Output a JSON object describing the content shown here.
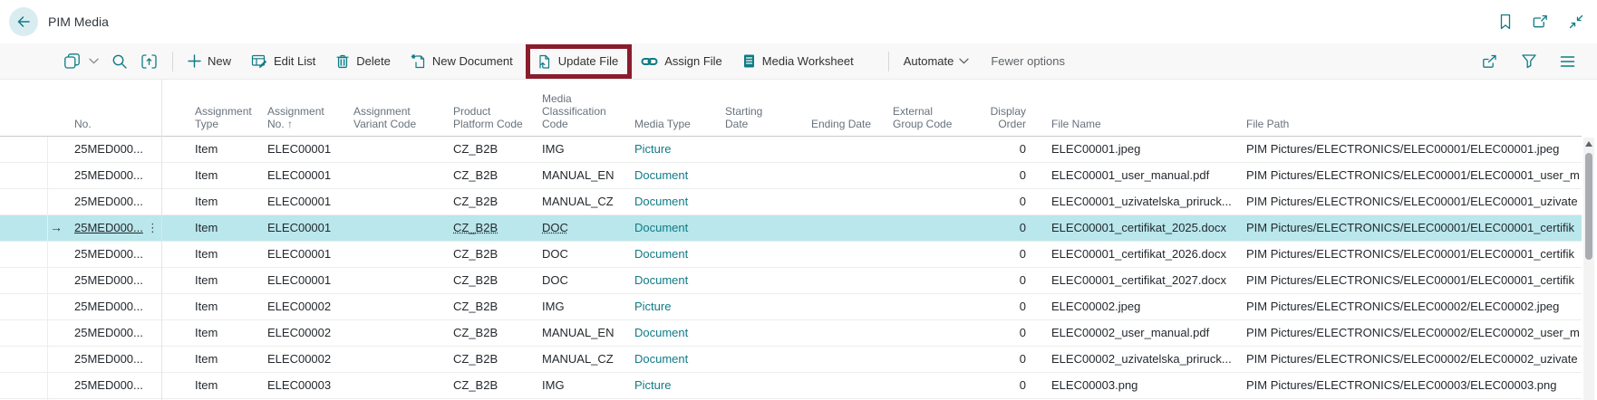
{
  "app_header": {
    "title": "PIM Media",
    "icons": [
      "back-arrow",
      "bookmark",
      "open-in-new-window",
      "collapse"
    ]
  },
  "command_bar": {
    "left_icons": [
      "views",
      "search",
      "analyze",
      "chevron-down"
    ],
    "buttons": [
      {
        "label": "New",
        "icon": "plus"
      },
      {
        "label": "Edit List",
        "icon": "table-edit"
      },
      {
        "label": "Delete",
        "icon": "trash"
      },
      {
        "label": "New Document",
        "icon": "document-new"
      },
      {
        "label": "Update File",
        "icon": "file-update",
        "highlighted": true
      },
      {
        "label": "Assign File",
        "icon": "chain-link"
      },
      {
        "label": "Media Worksheet",
        "icon": "worksheet"
      }
    ],
    "automate_label": "Automate",
    "fewer_options_label": "Fewer options",
    "right_icons": [
      "share",
      "filter-funnel",
      "column-options"
    ],
    "highlight_box_color": "#8a1c2c"
  },
  "table": {
    "columns": [
      {
        "key": "no",
        "label_lines": [
          "No."
        ]
      },
      {
        "key": "assignment_type",
        "label_lines": [
          "Assignment",
          "Type"
        ]
      },
      {
        "key": "assignment_no",
        "label_lines": [
          "Assignment",
          "No. ↑"
        ]
      },
      {
        "key": "assignment_variant_code",
        "label_lines": [
          "Assignment",
          "Variant Code"
        ]
      },
      {
        "key": "product_platform_code",
        "label_lines": [
          "Product",
          "Platform Code"
        ]
      },
      {
        "key": "media_classification_code",
        "label_lines": [
          "Media",
          "Classification",
          "Code"
        ]
      },
      {
        "key": "media_type",
        "label_lines": [
          "Media Type"
        ]
      },
      {
        "key": "starting_date",
        "label_lines": [
          "Starting",
          "Date"
        ]
      },
      {
        "key": "ending_date",
        "label_lines": [
          "Ending Date"
        ]
      },
      {
        "key": "external_group_code",
        "label_lines": [
          "External",
          "Group Code"
        ]
      },
      {
        "key": "display_order",
        "label_lines": [
          "Display",
          "Order"
        ]
      },
      {
        "key": "file_name",
        "label_lines": [
          "File Name"
        ]
      },
      {
        "key": "file_path",
        "label_lines": [
          "File Path"
        ]
      }
    ],
    "selected_row_index": 3,
    "selected_arrow_glyph": "→",
    "row_menu_glyph": "⋮",
    "rows": [
      {
        "no": "25MED000...",
        "assignment_type": "Item",
        "assignment_no": "ELEC00001",
        "assignment_variant_code": "",
        "product_platform_code": "CZ_B2B",
        "media_classification_code": "IMG",
        "media_type": "Picture",
        "starting_date": "",
        "ending_date": "",
        "external_group_code": "",
        "display_order": "0",
        "file_name": "ELEC00001.jpeg",
        "file_path": "PIM Pictures/ELECTRONICS/ELEC00001/ELEC00001.jpeg"
      },
      {
        "no": "25MED000...",
        "assignment_type": "Item",
        "assignment_no": "ELEC00001",
        "assignment_variant_code": "",
        "product_platform_code": "CZ_B2B",
        "media_classification_code": "MANUAL_EN",
        "media_type": "Document",
        "starting_date": "",
        "ending_date": "",
        "external_group_code": "",
        "display_order": "0",
        "file_name": "ELEC00001_user_manual.pdf",
        "file_path": "PIM Pictures/ELECTRONICS/ELEC00001/ELEC00001_user_m"
      },
      {
        "no": "25MED000...",
        "assignment_type": "Item",
        "assignment_no": "ELEC00001",
        "assignment_variant_code": "",
        "product_platform_code": "CZ_B2B",
        "media_classification_code": "MANUAL_CZ",
        "media_type": "Document",
        "starting_date": "",
        "ending_date": "",
        "external_group_code": "",
        "display_order": "0",
        "file_name": "ELEC00001_uzivatelska_priruck...",
        "file_path": "PIM Pictures/ELECTRONICS/ELEC00001/ELEC00001_uzivate"
      },
      {
        "no": "25MED000...",
        "assignment_type": "Item",
        "assignment_no": "ELEC00001",
        "assignment_variant_code": "",
        "product_platform_code": "CZ_B2B",
        "media_classification_code": "DOC",
        "media_type": "Document",
        "starting_date": "",
        "ending_date": "",
        "external_group_code": "",
        "display_order": "0",
        "file_name": "ELEC00001_certifikat_2025.docx",
        "file_path": "PIM Pictures/ELECTRONICS/ELEC00001/ELEC00001_certifik"
      },
      {
        "no": "25MED000...",
        "assignment_type": "Item",
        "assignment_no": "ELEC00001",
        "assignment_variant_code": "",
        "product_platform_code": "CZ_B2B",
        "media_classification_code": "DOC",
        "media_type": "Document",
        "starting_date": "",
        "ending_date": "",
        "external_group_code": "",
        "display_order": "0",
        "file_name": "ELEC00001_certifikat_2026.docx",
        "file_path": "PIM Pictures/ELECTRONICS/ELEC00001/ELEC00001_certifik"
      },
      {
        "no": "25MED000...",
        "assignment_type": "Item",
        "assignment_no": "ELEC00001",
        "assignment_variant_code": "",
        "product_platform_code": "CZ_B2B",
        "media_classification_code": "DOC",
        "media_type": "Document",
        "starting_date": "",
        "ending_date": "",
        "external_group_code": "",
        "display_order": "0",
        "file_name": "ELEC00001_certifikat_2027.docx",
        "file_path": "PIM Pictures/ELECTRONICS/ELEC00001/ELEC00001_certifik"
      },
      {
        "no": "25MED000...",
        "assignment_type": "Item",
        "assignment_no": "ELEC00002",
        "assignment_variant_code": "",
        "product_platform_code": "CZ_B2B",
        "media_classification_code": "IMG",
        "media_type": "Picture",
        "starting_date": "",
        "ending_date": "",
        "external_group_code": "",
        "display_order": "0",
        "file_name": "ELEC00002.jpeg",
        "file_path": "PIM Pictures/ELECTRONICS/ELEC00002/ELEC00002.jpeg"
      },
      {
        "no": "25MED000...",
        "assignment_type": "Item",
        "assignment_no": "ELEC00002",
        "assignment_variant_code": "",
        "product_platform_code": "CZ_B2B",
        "media_classification_code": "MANUAL_EN",
        "media_type": "Document",
        "starting_date": "",
        "ending_date": "",
        "external_group_code": "",
        "display_order": "0",
        "file_name": "ELEC00002_user_manual.pdf",
        "file_path": "PIM Pictures/ELECTRONICS/ELEC00002/ELEC00002_user_m"
      },
      {
        "no": "25MED000...",
        "assignment_type": "Item",
        "assignment_no": "ELEC00002",
        "assignment_variant_code": "",
        "product_platform_code": "CZ_B2B",
        "media_classification_code": "MANUAL_CZ",
        "media_type": "Document",
        "starting_date": "",
        "ending_date": "",
        "external_group_code": "",
        "display_order": "0",
        "file_name": "ELEC00002_uzivatelska_priruck...",
        "file_path": "PIM Pictures/ELECTRONICS/ELEC00002/ELEC00002_uzivate"
      },
      {
        "no": "25MED000...",
        "assignment_type": "Item",
        "assignment_no": "ELEC00003",
        "assignment_variant_code": "",
        "product_platform_code": "CZ_B2B",
        "media_classification_code": "IMG",
        "media_type": "Picture",
        "starting_date": "",
        "ending_date": "",
        "external_group_code": "",
        "display_order": "0",
        "file_name": "ELEC00003.png",
        "file_path": "PIM Pictures/ELECTRONICS/ELEC00003/ELEC00003.png"
      }
    ]
  },
  "colors": {
    "accent_teal": "#0f7b85",
    "selected_row_bg": "#b9e7ec",
    "annotation_red": "#8a1c2c"
  }
}
